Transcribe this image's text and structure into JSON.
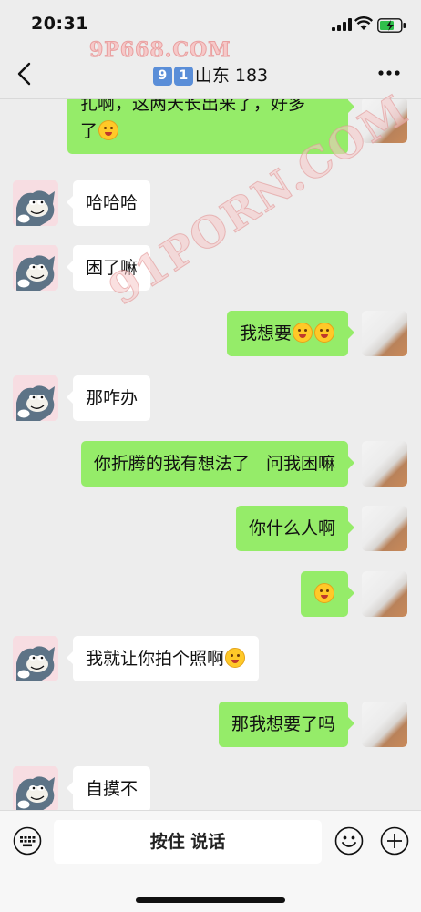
{
  "status": {
    "time": "20:31"
  },
  "header": {
    "keycap1": "9",
    "keycap2": "1",
    "title": "山东 183"
  },
  "watermarks": {
    "top": "9P668.COM",
    "diagonal": "91PORN.COM"
  },
  "messages": [
    {
      "side": "me",
      "text": "扎啊，这两天长出来了，好多",
      "text2": "了",
      "emoji_count": 1
    },
    {
      "side": "other",
      "text": "哈哈哈"
    },
    {
      "side": "other",
      "text": "困了嘛"
    },
    {
      "side": "me",
      "text": "我想要",
      "emoji_count": 2
    },
    {
      "side": "other",
      "text": "那咋办"
    },
    {
      "side": "me",
      "text": "你折腾的我有想法了   问我困嘛"
    },
    {
      "side": "me",
      "text": "你什么人啊"
    },
    {
      "side": "me",
      "text": "",
      "emoji_count": 1
    },
    {
      "side": "other",
      "text": "我就让你拍个照啊",
      "emoji_count": 1
    },
    {
      "side": "me",
      "text": "那我想要了吗"
    },
    {
      "side": "other",
      "text": "自摸不"
    }
  ],
  "input_bar": {
    "hold_to_talk": "按住 说话"
  },
  "icons": {
    "back": "back-chevron-icon",
    "more": "more-icon",
    "voice_keyboard": "keyboard-icon",
    "emoji": "emoji-icon",
    "plus": "plus-icon"
  },
  "colors": {
    "bubble_me": "#95ec69",
    "bubble_other": "#ffffff",
    "background": "#ededed"
  }
}
